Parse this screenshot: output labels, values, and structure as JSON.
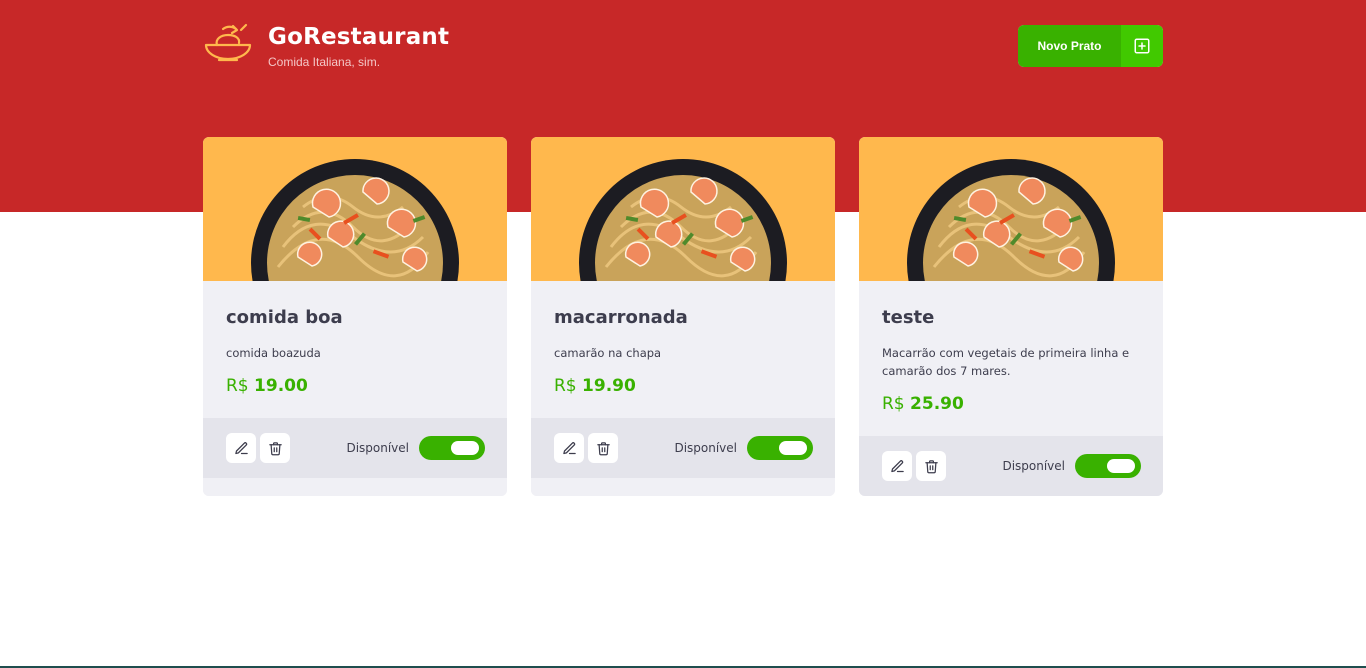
{
  "header": {
    "logo_icon": "bowl-icon",
    "title": "GoRestaurant",
    "subtitle": "Comida Italiana, sim.",
    "new_button_label": "Novo Prato",
    "new_button_icon": "plus-square-icon"
  },
  "colors": {
    "header_bg": "#c72828",
    "accent_green": "#39b100",
    "image_bg": "#ffb84d",
    "card_bg": "#f0f0f5",
    "footer_bg": "#e4e4eb"
  },
  "foods": [
    {
      "name": "comida boa",
      "description": "comida boazuda",
      "currency": "R$",
      "price": "19.00",
      "available_label": "Disponível",
      "available": true
    },
    {
      "name": "macarronada",
      "description": "camarão na chapa",
      "currency": "R$",
      "price": "19.90",
      "available_label": "Disponível",
      "available": true
    },
    {
      "name": "teste",
      "description": "Macarrão com vegetais de primeira linha e camarão dos 7 mares.",
      "currency": "R$",
      "price": "25.90",
      "available_label": "Disponível",
      "available": true
    }
  ]
}
